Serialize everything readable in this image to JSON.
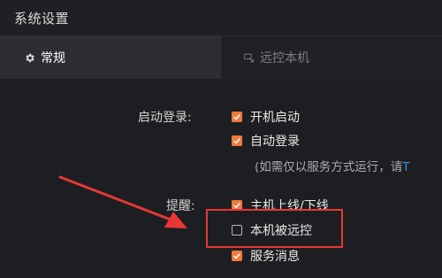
{
  "window": {
    "title": "系统设置"
  },
  "tabs": [
    {
      "label": "常规",
      "icon": "gear-icon",
      "active": true
    },
    {
      "label": "远控本机",
      "icon": "remote-control-icon",
      "active": false
    }
  ],
  "startup": {
    "label": "启动登录:",
    "options": [
      {
        "label": "开机启动",
        "checked": true
      },
      {
        "label": "自动登录",
        "checked": true
      }
    ],
    "hint": "(如需仅以服务方式运行，请",
    "hint_link": "T"
  },
  "reminder": {
    "label": "提醒:",
    "options": [
      {
        "label": "主机上线/下线",
        "checked": true
      },
      {
        "label": "本机被远控",
        "checked": false
      },
      {
        "label": "服务消息",
        "checked": true
      }
    ]
  },
  "colors": {
    "accent": "#f07a3c",
    "annotation": "#e93734",
    "link": "#3f8ce8"
  }
}
